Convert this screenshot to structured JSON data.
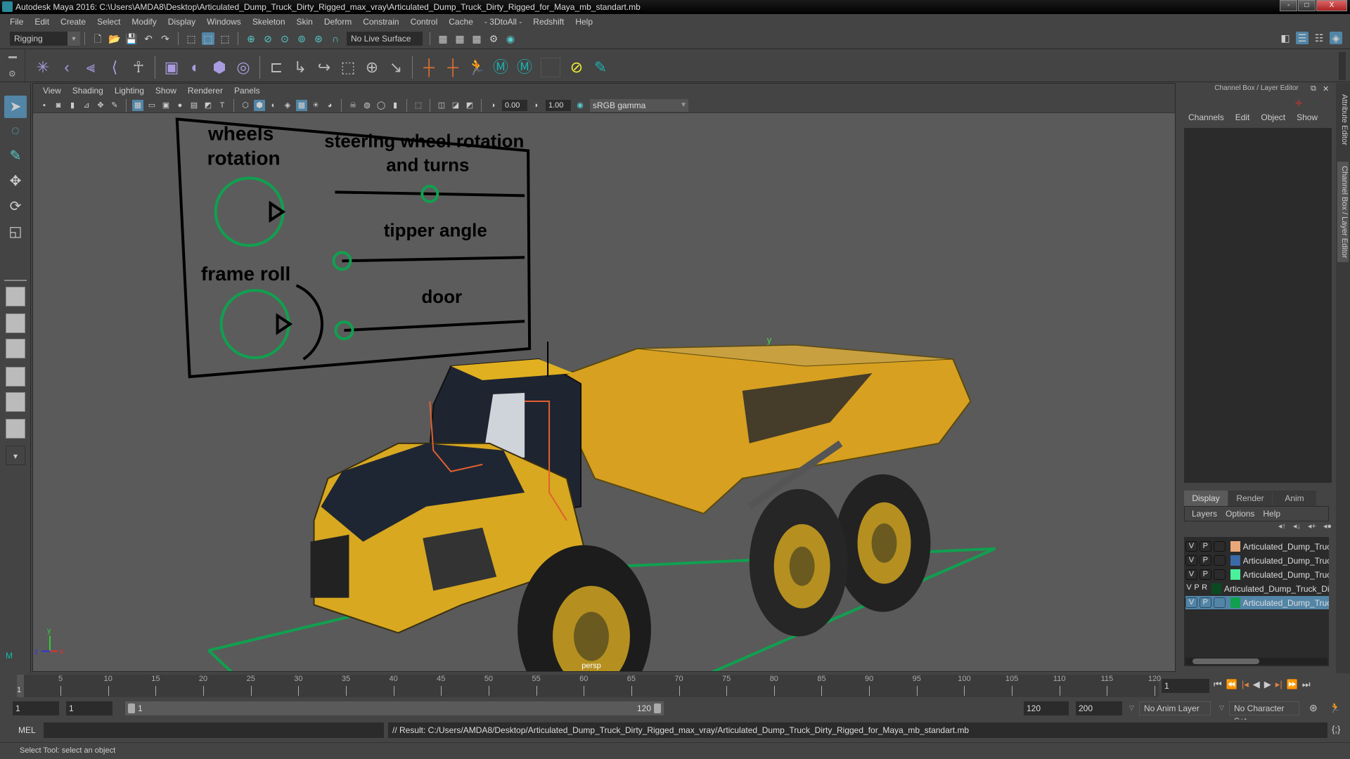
{
  "window": {
    "title": "Autodesk Maya 2016: C:\\Users\\AMDA8\\Desktop\\Articulated_Dump_Truck_Dirty_Rigged_max_vray\\Articulated_Dump_Truck_Dirty_Rigged_for_Maya_mb_standart.mb",
    "minimize": "-",
    "restore": "□",
    "close": "X"
  },
  "menubar": [
    "File",
    "Edit",
    "Create",
    "Select",
    "Modify",
    "Display",
    "Windows",
    "Skeleton",
    "Skin",
    "Deform",
    "Constrain",
    "Control",
    "Cache",
    "- 3DtoAll -",
    "Redshift",
    "Help"
  ],
  "statusline": {
    "mode": "Rigging",
    "live_surface": "No Live Surface"
  },
  "viewport": {
    "menu": [
      "View",
      "Shading",
      "Lighting",
      "Show",
      "Renderer",
      "Panels"
    ],
    "exposure": "0.00",
    "gamma": "1.00",
    "color_space": "sRGB gamma",
    "camera_label": "persp",
    "rig_panel": {
      "wheels_label": [
        "wheels",
        "rotation"
      ],
      "steering_label": [
        "steering wheel rotation",
        "and turns"
      ],
      "tipper_label": "tipper angle",
      "frame_roll_label": "frame roll",
      "door_label": "door",
      "steering_value": 0.5,
      "tipper_value": 0.0,
      "door_value": 0.0
    },
    "axis": {
      "x": "x",
      "y": "y",
      "z": "z"
    }
  },
  "channel_box": {
    "title": "Channel Box / Layer Editor",
    "menu": [
      "Channels",
      "Edit",
      "Object",
      "Show"
    ],
    "side_tabs": [
      "Attribute Editor",
      "Channel Box / Layer Editor"
    ]
  },
  "layer_editor": {
    "tabs": [
      "Display",
      "Render",
      "Anim"
    ],
    "active_tab": "Display",
    "menu": [
      "Layers",
      "Options",
      "Help"
    ],
    "layers": [
      {
        "v": "V",
        "p": "P",
        "r": "",
        "color": "#e8a878",
        "name": "Articulated_Dump_Truck",
        "selected": false
      },
      {
        "v": "V",
        "p": "P",
        "r": "",
        "color": "#3a6aa8",
        "name": "Articulated_Dump_Truck",
        "selected": false
      },
      {
        "v": "V",
        "p": "P",
        "r": "",
        "color": "#4af09a",
        "name": "Articulated_Dump_Truck",
        "selected": false
      },
      {
        "v": "V",
        "p": "P",
        "r": "R",
        "color": "#0a4a20",
        "name": "Articulated_Dump_Truck_Dirty",
        "selected": false
      },
      {
        "v": "V",
        "p": "P",
        "r": "",
        "color": "#10a050",
        "name": "Articulated_Dump_Truck",
        "selected": true
      }
    ]
  },
  "timeline": {
    "ticks": [
      1,
      5,
      10,
      15,
      20,
      25,
      30,
      35,
      40,
      45,
      50,
      55,
      60,
      65,
      70,
      75,
      80,
      85,
      90,
      95,
      100,
      105,
      110,
      115,
      120
    ],
    "start": 1,
    "end": 120,
    "current_frame": "1"
  },
  "range": {
    "start": "1",
    "anim_start": "1",
    "slider_start": "1",
    "slider_end": "120",
    "end": "120",
    "anim_end": "200",
    "anim_layer": "No Anim Layer",
    "character_set": "No Character Set"
  },
  "command": {
    "lang": "MEL",
    "result": "// Result: C:/Users/AMDA8/Desktop/Articulated_Dump_Truck_Dirty_Rigged_max_vray/Articulated_Dump_Truck_Dirty_Rigged_for_Maya_mb_standart.mb"
  },
  "status_help": "Select Tool: select an object",
  "colors": {
    "accent": "#5285a6",
    "rig_green": "#10a050",
    "truck_yellow": "#e8b020"
  }
}
